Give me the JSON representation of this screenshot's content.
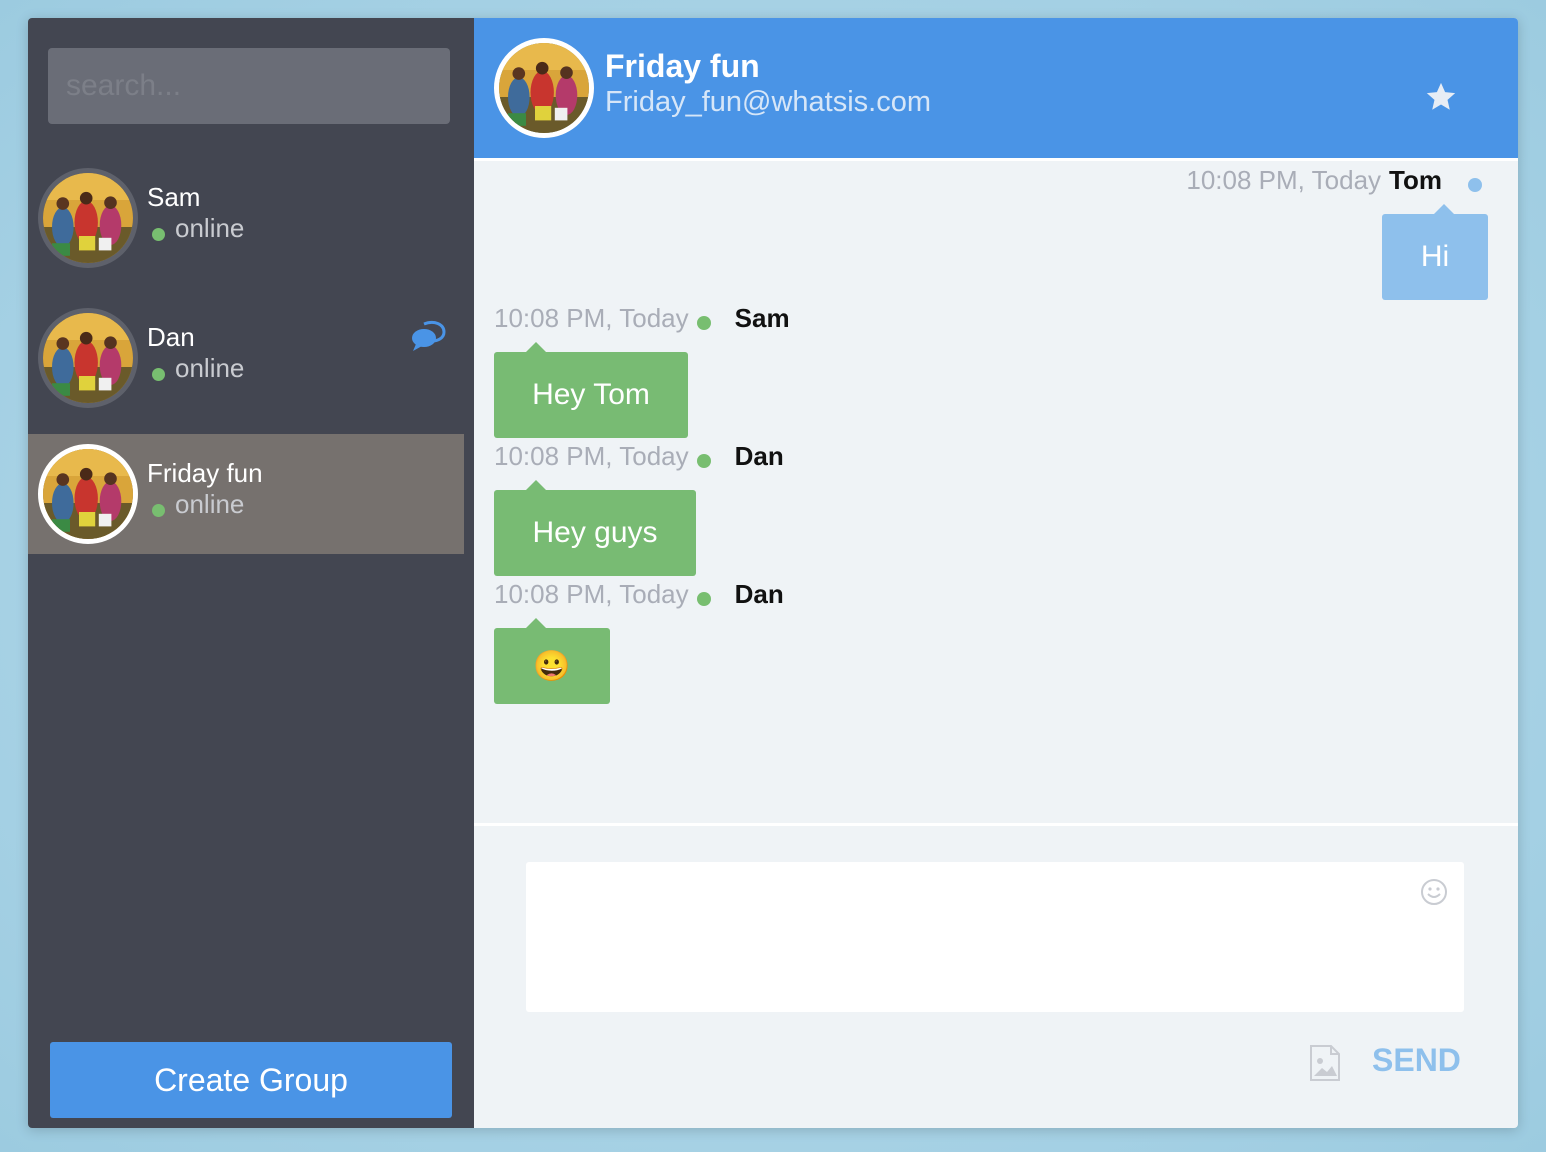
{
  "search": {
    "placeholder": "search..."
  },
  "contacts": [
    {
      "name": "Sam",
      "status": "online",
      "avatar": "group-photo-avatar"
    },
    {
      "name": "Dan",
      "status": "online",
      "avatar": "group-photo-avatar",
      "badge_icon": "chat-bubbles-icon"
    },
    {
      "name": "Friday fun",
      "status": "online",
      "avatar": "group-photo-avatar",
      "active": true
    }
  ],
  "sidebar": {
    "create_group_label": "Create Group"
  },
  "header": {
    "title": "Friday fun",
    "email": "Friday_fun@whatsis.com",
    "star_icon": "star-icon"
  },
  "messages": [
    {
      "time": "10:08 PM, Today",
      "author": "Tom",
      "text": "Hi",
      "side": "right"
    },
    {
      "time": "10:08 PM, Today",
      "author": "Sam",
      "text": "Hey Tom",
      "side": "left"
    },
    {
      "time": "10:08 PM, Today",
      "author": "Dan",
      "text": "Hey guys",
      "side": "left"
    },
    {
      "time": "10:08 PM, Today",
      "author": "Dan",
      "text": "😀",
      "side": "left"
    }
  ],
  "composer": {
    "value": "",
    "send_label": "SEND"
  },
  "colors": {
    "sidebar": "#434651",
    "active_contact": "#76716e",
    "accent": "#4a94e6",
    "incoming_bubble": "#78bb73",
    "outgoing_bubble": "#8ec0ec",
    "online": "#78be70"
  }
}
